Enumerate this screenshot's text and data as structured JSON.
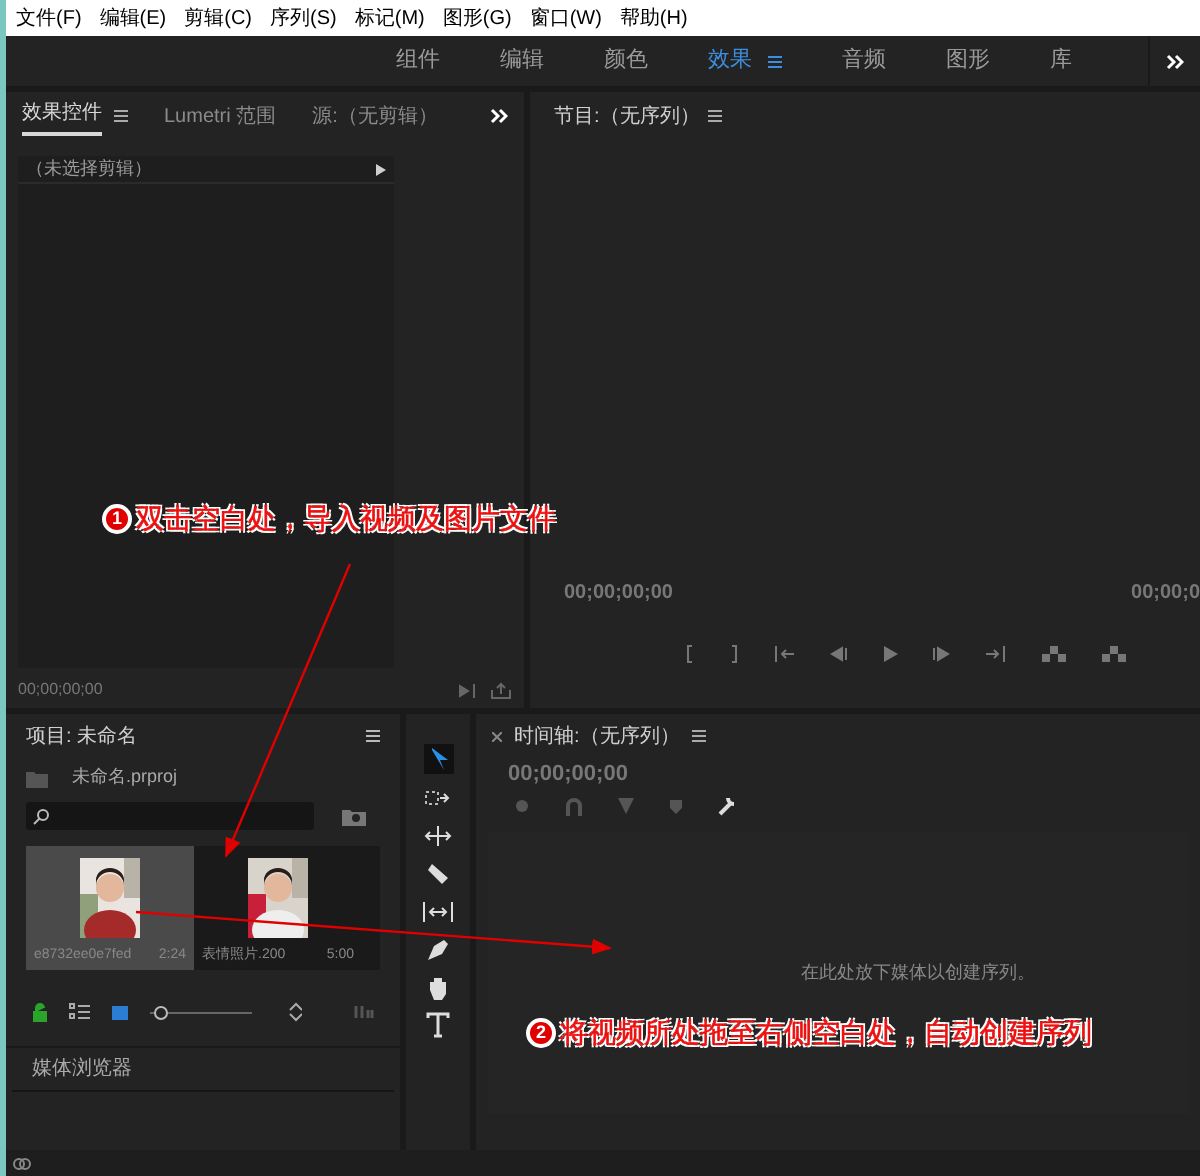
{
  "menu": [
    "文件(F)",
    "编辑(E)",
    "剪辑(C)",
    "序列(S)",
    "标记(M)",
    "图形(G)",
    "窗口(W)",
    "帮助(H)"
  ],
  "workspaces": [
    {
      "label": "组件",
      "selected": false
    },
    {
      "label": "编辑",
      "selected": false
    },
    {
      "label": "颜色",
      "selected": false
    },
    {
      "label": "效果",
      "selected": true
    },
    {
      "label": "音频",
      "selected": false
    },
    {
      "label": "图形",
      "selected": false
    },
    {
      "label": "库",
      "selected": false
    }
  ],
  "source_tabs": [
    {
      "label": "效果控件",
      "selected": true
    },
    {
      "label": "Lumetri 范围",
      "selected": false
    },
    {
      "label": "源:（无剪辑）",
      "selected": false
    }
  ],
  "effect_controls": {
    "clip": "（未选择剪辑）",
    "timecode": "00;00;00;00"
  },
  "program": {
    "title": "节目:（无序列）",
    "timecode_left": "00;00;00;00",
    "timecode_right": "00;00;0"
  },
  "project": {
    "title": "项目: 未命名",
    "file": "未命名.prproj",
    "items": [
      {
        "name": "e8732ee0e7fed",
        "duration": "2:24",
        "selected": true
      },
      {
        "name": "表情照片.200",
        "duration": "5:00",
        "selected": false
      }
    ],
    "media_browser": "媒体浏览器",
    "zoom_slider": {
      "level": 0.05
    }
  },
  "timeline": {
    "title": "时间轴:（无序列）",
    "timecode": "00;00;00;00",
    "hint": "在此处放下媒体以创建序列。"
  },
  "annotations": [
    {
      "number": "1",
      "text": "双击空白处，导入视频及图片文件"
    },
    {
      "number": "2",
      "text": "将视频所处拖至右侧空白处，自动创建序列"
    }
  ]
}
